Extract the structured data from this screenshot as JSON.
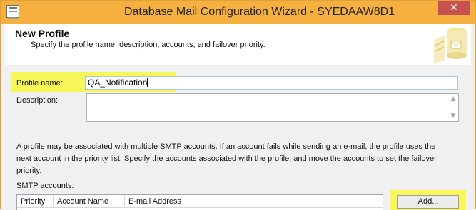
{
  "window": {
    "title": "Database Mail Configuration Wizard - SYEDAAW8D1",
    "close_glyph": "✕"
  },
  "header": {
    "title": "New Profile",
    "subtitle": "Specify the profile name, description, accounts, and failover priority."
  },
  "form": {
    "profile_name_label": "Profile name:",
    "profile_name_value": "QA_Notification",
    "description_label": "Description:",
    "description_value": ""
  },
  "info_text": "A profile may be associated with multiple SMTP accounts. If an account fails while sending an e-mail, the profile uses the next account in the priority list. Specify the accounts associated with the profile, and move the accounts to set the failover priority.",
  "smtp": {
    "label": "SMTP accounts:",
    "columns": [
      "Priority",
      "Account Name",
      "E-mail Address"
    ],
    "add_button": "Add..."
  },
  "icons": {
    "app": "wizard-window-icon",
    "header": "database-mail-icon",
    "scroll_up": "▲",
    "scroll_down": "▼"
  },
  "colors": {
    "titlebar": "#f6b040",
    "highlight": "#f7f75a",
    "close": "#c75050"
  }
}
